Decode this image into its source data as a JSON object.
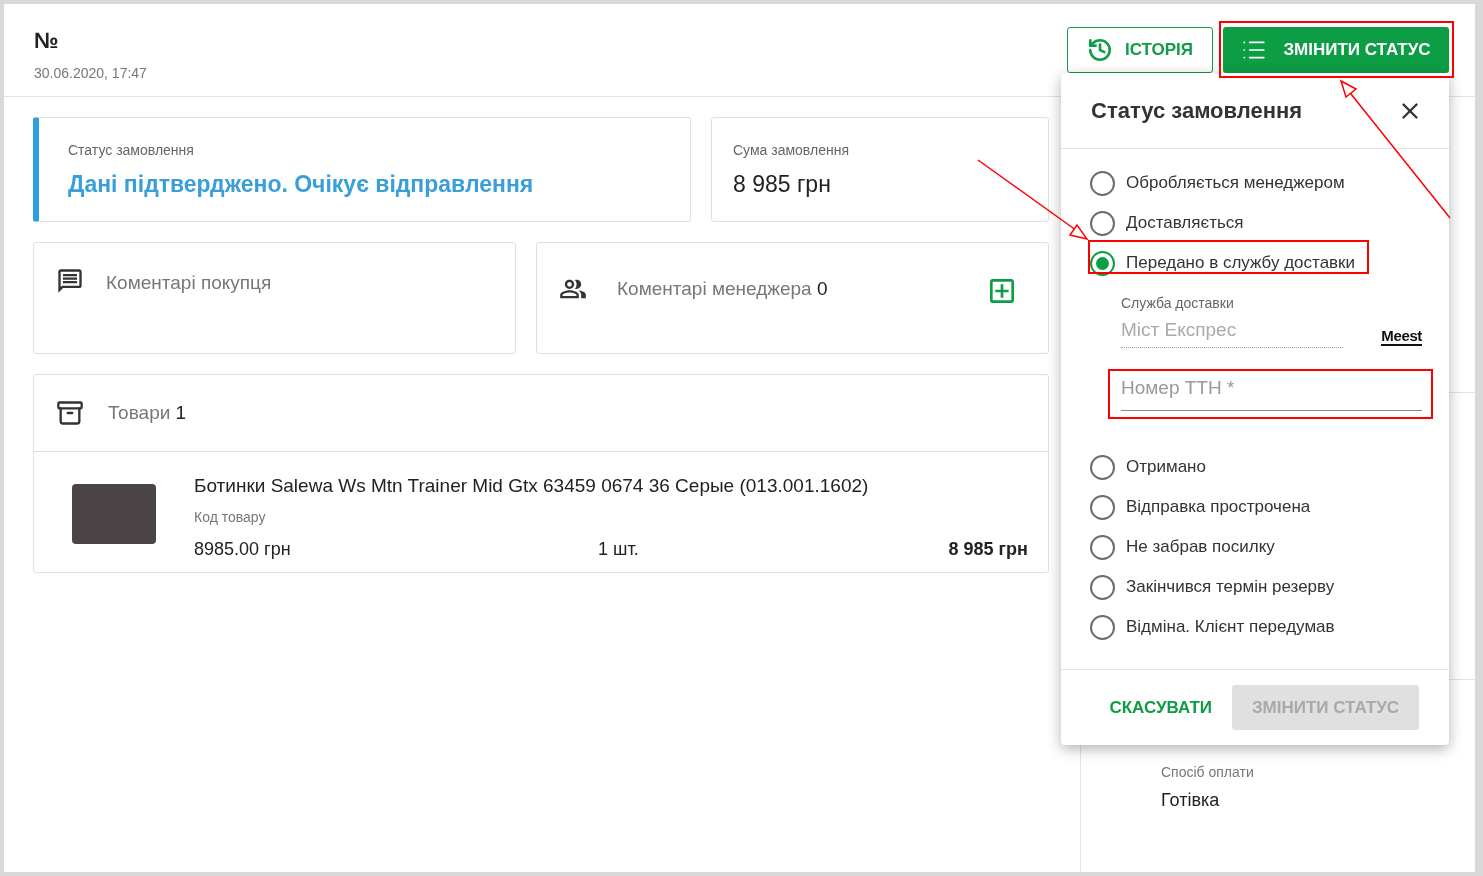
{
  "order": {
    "number_label": "№",
    "date": "30.06.2020, 17:47"
  },
  "header_buttons": [
    {
      "label": "ІСТОРІЯ",
      "kind": "outlined"
    },
    {
      "label": "ЗМІНИТИ СТАТУС",
      "kind": "primary"
    }
  ],
  "status_card": {
    "label": "Статус замовлення",
    "value": "Дані підтверджено. Очікує відправлення"
  },
  "sum_card": {
    "label": "Сума замовлення",
    "value": "8 985 грн"
  },
  "buyer_comments": {
    "title": "Коментарі покупця"
  },
  "manager_comments": {
    "title": "Коментарі менеджера",
    "count": "0"
  },
  "products": {
    "title": "Товари",
    "count": "1",
    "items": [
      {
        "name": "Ботинки Salewa Ws Mtn Trainer Mid Gtx 63459 0674 36 Серые (013.001.1602)",
        "code_label": "Код товару",
        "price": "8985.00 грн",
        "quantity": "1 шт.",
        "total": "8 985 грн"
      }
    ]
  },
  "sidebar": {
    "payment_label": "Спосіб оплати",
    "payment_value": "Готівка"
  },
  "status_dialog": {
    "title": "Статус замовлення",
    "options": [
      {
        "label": "Обробляється менеджером",
        "selected": false
      },
      {
        "label": "Доставляється",
        "selected": false
      },
      {
        "label": "Передано в службу доставки",
        "selected": true
      },
      {
        "label": "Отримано",
        "selected": false
      },
      {
        "label": "Відправка прострочена",
        "selected": false
      },
      {
        "label": "Не забрав посилку",
        "selected": false
      },
      {
        "label": "Закінчився термін резерву",
        "selected": false
      },
      {
        "label": "Відміна. Клієнт передумав",
        "selected": false
      }
    ],
    "delivery": {
      "label": "Служба доставки",
      "value": "Міст Експрес",
      "logo_text": "Meest"
    },
    "ttn": {
      "placeholder": "Номер ТТН *"
    },
    "cancel": "СКАСУВАТИ",
    "submit": {
      "label": "ЗМІНИТИ СТАТУС",
      "disabled": true
    }
  }
}
